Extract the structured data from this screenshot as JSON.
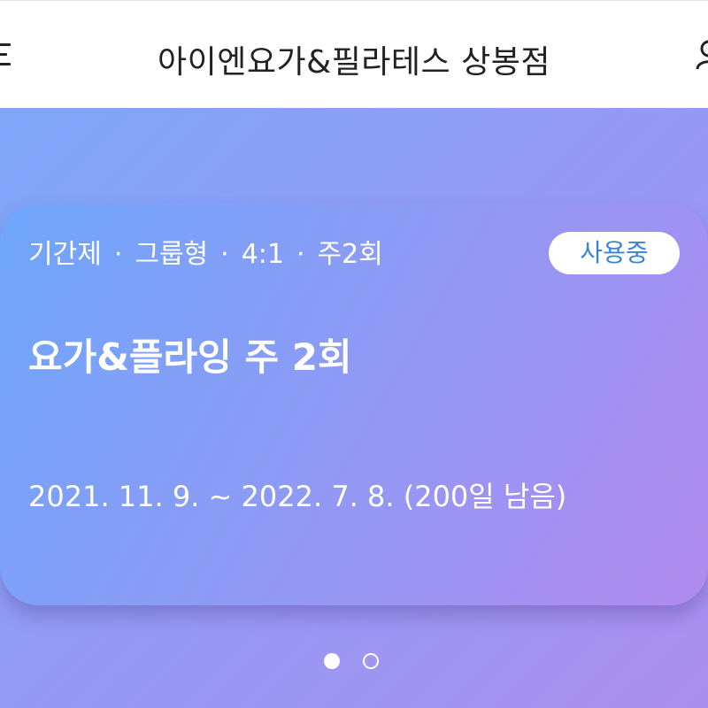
{
  "header": {
    "title": "아이엔요가&필라테스 상봉점",
    "menu_icon": "hamburger-menu-icon",
    "user_icon": "user-icon"
  },
  "pass_card": {
    "tags": [
      "기간제",
      "그룹형",
      "4:1",
      "주2회"
    ],
    "tag_separator": "·",
    "status": "사용중",
    "title": "요가&플라잉 주 2회",
    "period": "2021. 11. 9. ~ 2022. 7. 8. (200일 남음)"
  },
  "pagination": {
    "total": 2,
    "current": 1
  },
  "colors": {
    "status_text": "#3a84d8",
    "card_gradient_start": "#6ea6fb",
    "card_gradient_end": "#b18aef"
  }
}
